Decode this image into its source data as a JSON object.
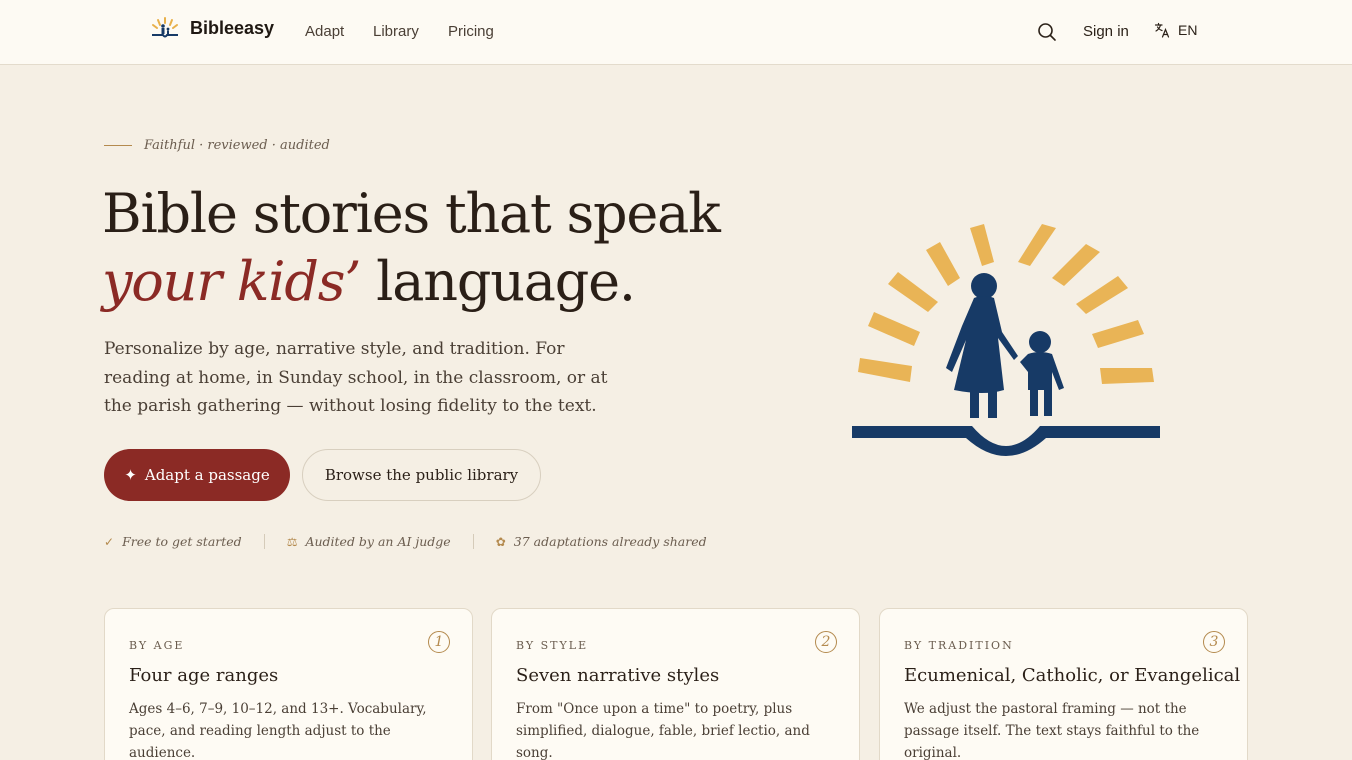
{
  "header": {
    "brand": "Bibleeasy",
    "nav": [
      "Adapt",
      "Library",
      "Pricing"
    ],
    "signin": "Sign in",
    "language": "EN"
  },
  "hero": {
    "eyebrow": "Faithful · reviewed · audited",
    "headline_line1": "Bible stories that speak",
    "headline_accent": "your kids’",
    "headline_rest": " language.",
    "lede": "Personalize by age, narrative style, and tradition. For reading at home, in Sunday school, in the classroom, or at the parish gathering — without losing fidelity to the text.",
    "primary_cta": "Adapt a passage",
    "primary_cta_icon": "✦",
    "secondary_cta": "Browse the public library",
    "trust": [
      {
        "icon": "✓",
        "text": "Free to get started"
      },
      {
        "icon": "⚖",
        "text": "Audited by an AI judge"
      },
      {
        "icon": "✿",
        "text": "37 adaptations already shared"
      }
    ]
  },
  "cards": [
    {
      "label": "BY AGE",
      "num": "1",
      "title": "Four age ranges",
      "body": "Ages 4–6, 7–9, 10–12, and 13+. Vocabulary, pace, and reading length adjust to the audience."
    },
    {
      "label": "BY STYLE",
      "num": "2",
      "title": "Seven narrative styles",
      "body": "From \"Once upon a time\" to poetry, plus simplified, dialogue, fable, brief lectio, and song."
    },
    {
      "label": "BY TRADITION",
      "num": "3",
      "title": "Ecumenical, Catholic, or Evangelical",
      "body": "We adjust the pastoral framing — not the passage itself. The text stays faithful to the original."
    }
  ],
  "colors": {
    "accent": "#8b2a25",
    "gold": "#e8b04a",
    "navy": "#173a66",
    "background": "#f5efe4"
  }
}
